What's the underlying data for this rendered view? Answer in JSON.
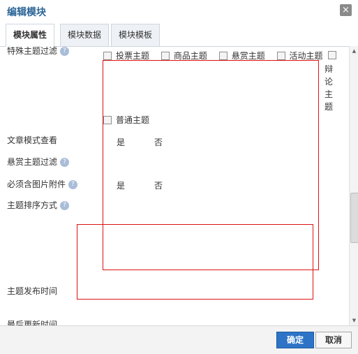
{
  "dialog": {
    "title": "编辑模块",
    "close_icon": "×"
  },
  "tabs": [
    {
      "label": "模块属性",
      "active": true
    },
    {
      "label": "模块数据",
      "active": false
    },
    {
      "label": "模块模板",
      "active": false
    }
  ],
  "form": {
    "row_filter_label": "特殊主题过滤",
    "checkboxes": [
      "投票主题",
      "商品主题",
      "悬赏主题",
      "活动主题",
      "辩论主题"
    ],
    "normal_topic": "普通主题",
    "article_mode_label": "文章模式查看",
    "reward_filter_label": "悬赏主题过滤",
    "must_image_label": "必须含图片附件",
    "sort_label": "主题排序方式",
    "publish_time_label": "主题发布时间",
    "last_update_label": "最后更新时间",
    "yes": "是",
    "no": "否"
  },
  "footer": {
    "ok_label": "确定",
    "cancel_label": "取消"
  },
  "colors": {
    "accent": "#2d74c7",
    "highlight_box": "#dd1111"
  }
}
